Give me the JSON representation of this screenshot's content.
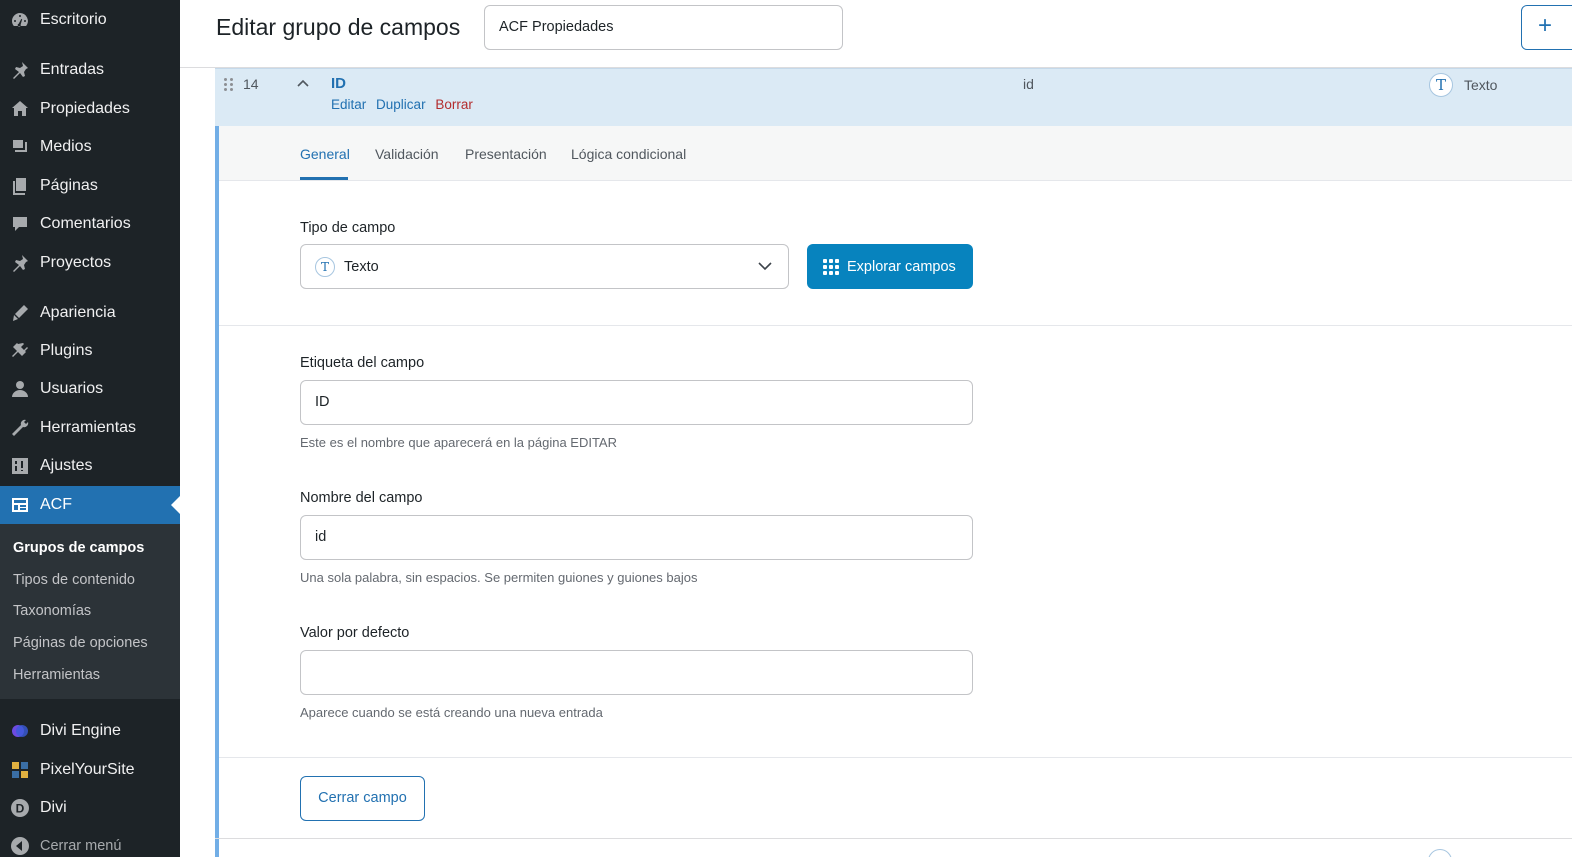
{
  "sidebar": {
    "items": [
      {
        "label": "Escritorio",
        "icon": "dashboard-icon"
      },
      {
        "label": "Entradas",
        "icon": "pin-icon"
      },
      {
        "label": "Propiedades",
        "icon": "properties-icon"
      },
      {
        "label": "Medios",
        "icon": "media-icon"
      },
      {
        "label": "Páginas",
        "icon": "pages-icon"
      },
      {
        "label": "Comentarios",
        "icon": "comments-icon"
      },
      {
        "label": "Proyectos",
        "icon": "pin-icon"
      },
      {
        "label": "Apariencia",
        "icon": "appearance-icon"
      },
      {
        "label": "Plugins",
        "icon": "plugins-icon"
      },
      {
        "label": "Usuarios",
        "icon": "users-icon"
      },
      {
        "label": "Herramientas",
        "icon": "tools-icon"
      },
      {
        "label": "Ajustes",
        "icon": "settings-icon"
      },
      {
        "label": "ACF",
        "icon": "acf-icon"
      },
      {
        "label": "Divi Engine",
        "icon": "divi-engine-icon"
      },
      {
        "label": "PixelYourSite",
        "icon": "pixelyoursite-icon"
      },
      {
        "label": "Divi",
        "icon": "divi-icon"
      },
      {
        "label": "Cerrar menú",
        "icon": "collapse-menu-icon"
      }
    ],
    "submenu": [
      {
        "label": "Grupos de campos"
      },
      {
        "label": "Tipos de contenido"
      },
      {
        "label": "Taxonomías"
      },
      {
        "label": "Páginas de opciones"
      },
      {
        "label": "Herramientas"
      }
    ]
  },
  "header": {
    "title": "Editar grupo de campos",
    "group_title_value": "ACF Propiedades",
    "add_button_icon": "+"
  },
  "field_row": {
    "order": "14",
    "label": "ID",
    "actions": {
      "edit": "Editar",
      "duplicate": "Duplicar",
      "delete": "Borrar"
    },
    "name": "id",
    "type": "Texto",
    "type_badge": "T"
  },
  "tabs": [
    {
      "label": "General",
      "active": true
    },
    {
      "label": "Validación",
      "active": false
    },
    {
      "label": "Presentación",
      "active": false
    },
    {
      "label": "Lógica condicional",
      "active": false
    }
  ],
  "settings": {
    "field_type": {
      "label": "Tipo de campo",
      "value": "Texto",
      "badge": "T",
      "browse_label": "Explorar campos"
    },
    "field_label": {
      "label": "Etiqueta del campo",
      "value": "ID",
      "help": "Este es el nombre que aparecerá en la página EDITAR"
    },
    "field_name": {
      "label": "Nombre del campo",
      "value": "id",
      "help": "Una sola palabra, sin espacios. Se permiten guiones y guiones bajos"
    },
    "default_value": {
      "label": "Valor por defecto",
      "value": "",
      "help": "Aparece cuando se está creando una nueva entrada"
    },
    "close_label": "Cerrar campo"
  },
  "colors": {
    "accent": "#2271b1",
    "sidebar": "#1d2327",
    "submenu": "#2c3338",
    "delete": "#b32d2e",
    "browse_button": "#0783be",
    "row_highlight": "#dbeaf5"
  }
}
